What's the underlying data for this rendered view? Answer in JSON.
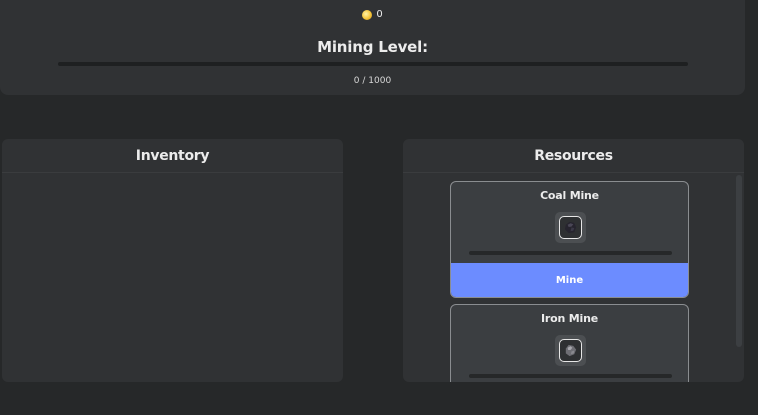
{
  "header": {
    "coin_icon": "coin-icon",
    "coins": "0",
    "level_title": "Mining Level:",
    "xp_text": "0 / 1000",
    "xp_current": 0,
    "xp_max": 1000
  },
  "inventory": {
    "title": "Inventory",
    "items": []
  },
  "resources": {
    "title": "Resources",
    "mines": [
      {
        "name": "Coal Mine",
        "ore_icon": "coal-ore-icon",
        "progress": 0,
        "button_label": "Mine"
      },
      {
        "name": "Iron Mine",
        "ore_icon": "iron-ore-icon",
        "progress": 0
      }
    ]
  },
  "colors": {
    "accent": "#6c8cff",
    "background": "#262829",
    "panel": "#303234",
    "card": "#3b3e41"
  }
}
